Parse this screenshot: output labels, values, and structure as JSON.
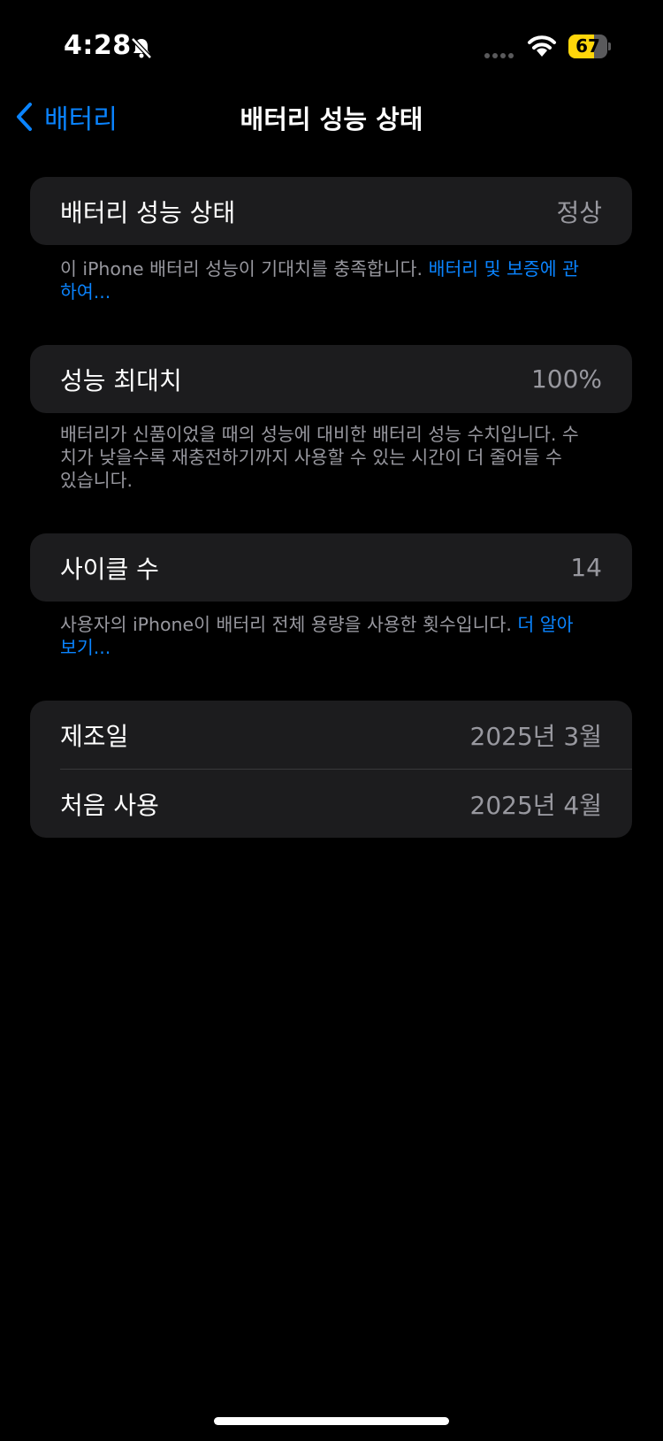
{
  "status_bar": {
    "time": "4:28",
    "battery_level": "67",
    "battery_fraction": 0.67
  },
  "nav": {
    "back_label": "배터리",
    "title": "배터리 성능 상태"
  },
  "health": {
    "label": "배터리 성능 상태",
    "value": "정상",
    "footnote_text": "이 iPhone 배터리 성능이 기대치를 충족합니다. ",
    "footnote_link": "배터리 및 보증에 관하여..."
  },
  "max_capacity": {
    "label": "성능 최대치",
    "value": "100%",
    "footnote": "배터리가 신품이었을 때의 성능에 대비한 배터리 성능 수치입니다. 수치가 낮을수록 재충전하기까지 사용할 수 있는 시간이 더 줄어들 수 있습니다."
  },
  "cycle_count": {
    "label": "사이클 수",
    "value": "14",
    "footnote_text": "사용자의 iPhone이 배터리 전체 용량을 사용한 횟수입니다. ",
    "footnote_link": "더 알아보기..."
  },
  "dates": {
    "manufacture_label": "제조일",
    "manufacture_value": "2025년 3월",
    "first_use_label": "처음 사용",
    "first_use_value": "2025년 4월"
  },
  "colors": {
    "accent": "#0a84ff",
    "background": "#000000",
    "card": "#1c1c1e",
    "secondary_text": "#98989f",
    "battery": "#ffd60a"
  }
}
